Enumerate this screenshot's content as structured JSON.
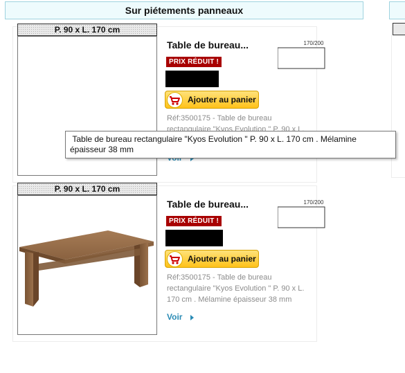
{
  "section": {
    "title": "Sur piétements panneaux"
  },
  "products": [
    {
      "dim_label": "P. 90 x L. 170 cm",
      "title": "Table de bureau...",
      "badge": "PRIX RÉDUIT !",
      "cart_label": "Ajouter au panier",
      "reference": "Réf:3500175 - Table de bureau rectangulaire \"Kyos Evolution \" P. 90 x L. 170 cm . Mélamine épaisseur 38 mm",
      "voir": "Voir",
      "diagram_width": "170/200",
      "diagram_depth": "90",
      "image_loaded": false
    },
    {
      "dim_label": "P. 90 x L. 170 cm",
      "title": "Table de bureau...",
      "badge": "PRIX RÉDUIT !",
      "cart_label": "Ajouter au panier",
      "reference": "Réf:3500175 - Table de bureau rectangulaire \"Kyos Evolution \" P. 90 x L. 170 cm . Mélamine épaisseur 38 mm",
      "voir": "Voir",
      "diagram_width": "170/200",
      "diagram_depth": "90",
      "image_loaded": true
    }
  ],
  "tooltip": {
    "text": " Table de bureau rectangulaire \"Kyos Evolution \" P. 90 x L. 170 cm . Mélamine épaisseur 38 mm"
  },
  "colors": {
    "badge": "#a80000",
    "link": "#2a8bb5",
    "header_bg": "#eefbfd",
    "button": "#ffc21a"
  },
  "icons": {
    "cart": "shopping-cart-icon",
    "voir": "arrow-right-icon"
  }
}
